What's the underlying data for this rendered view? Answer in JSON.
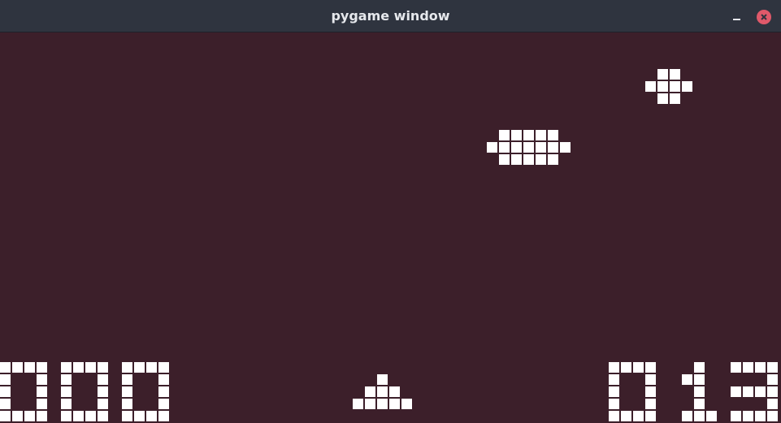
{
  "window": {
    "title": "pygame window",
    "minimize_icon": "minimize-icon",
    "close_icon": "close-icon",
    "close_color": "#e0596a",
    "titlebar_color": "#2f343f"
  },
  "game": {
    "background_color": "#3c1f2a",
    "pixel_color": "#ffffff",
    "score_left": "000",
    "score_right": "013",
    "sprites": {
      "small_ship": [
        "01100",
        "11110",
        "01100"
      ],
      "big_ship": [
        "0111110",
        "1111111",
        "0111110"
      ],
      "player_cannon": [
        "00100",
        "01110",
        "11111"
      ]
    },
    "digits": {
      "0": [
        "1111",
        "1001",
        "1001",
        "1001",
        "1111"
      ],
      "1": [
        "0010",
        "0110",
        "0010",
        "0010",
        "0111"
      ],
      "3": [
        "1111",
        "0001",
        "1111",
        "0001",
        "1111"
      ]
    }
  }
}
